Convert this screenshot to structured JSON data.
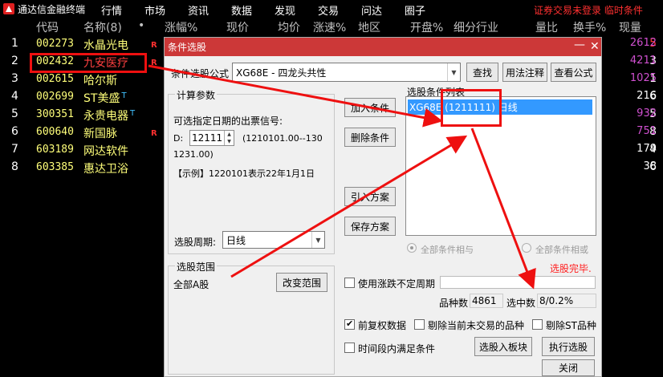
{
  "app": {
    "title": "通达信金融终端"
  },
  "menu": [
    "行情",
    "市场",
    "资讯",
    "数据",
    "发现",
    "交易",
    "问达",
    "圈子"
  ],
  "status_msg": "证券交易未登录 临时条件",
  "columns": [
    "代码",
    "名称(8)",
    "•",
    "涨幅%",
    "现价",
    "均价",
    "涨速%",
    "地区",
    "开盘%",
    "细分行业",
    "量比",
    "换手%",
    "现量"
  ],
  "rows": [
    {
      "idx": "1",
      "code": "002273",
      "name": "水晶光电",
      "flag": "R",
      "t": "",
      "tail": "5",
      "last": "2612"
    },
    {
      "idx": "2",
      "code": "002432",
      "name": "九安医疗",
      "flag": "R",
      "t": "",
      "tail": "3",
      "last": "4211"
    },
    {
      "idx": "3",
      "code": "002615",
      "name": "哈尔斯",
      "flag": "",
      "t": "",
      "tail": "1",
      "last": "1025"
    },
    {
      "idx": "4",
      "code": "002699",
      "name": "ST美盛",
      "flag": "",
      "t": "T",
      "tail": "6",
      "last": "216"
    },
    {
      "idx": "5",
      "code": "300351",
      "name": "永贵电器",
      "flag": "",
      "t": "T",
      "tail": "5",
      "last": "932"
    },
    {
      "idx": "6",
      "code": "600640",
      "name": "新国脉",
      "flag": "R",
      "t": "",
      "tail": "8",
      "last": "751"
    },
    {
      "idx": "7",
      "code": "603189",
      "name": "网达软件",
      "flag": "",
      "t": "",
      "tail": "4",
      "last": "179"
    },
    {
      "idx": "8",
      "code": "603385",
      "name": "惠达卫浴",
      "flag": "",
      "t": "",
      "tail": "6",
      "last": "38"
    }
  ],
  "colors": {
    "last_purple": "#d050d0",
    "last_white": "#ffffff",
    "tail_red": "#ff3030",
    "tail_white": "#ffffff"
  },
  "dialog": {
    "title": "条件选股",
    "formula_label": "条件选股公式",
    "formula_value": "XG68E         - 四龙头共性",
    "btn_find": "查找",
    "btn_usage": "用法注释",
    "btn_view": "查看公式",
    "params_caption": "计算参数",
    "params_hint": "可选指定日期的出票信号:",
    "d_label": "D:",
    "d_value": "12111",
    "d_range": "(1210101.00--130",
    "d_range2": "1231.00)",
    "example": "【示例】1220101表示22年1月1日",
    "btn_add": "加入条件",
    "btn_del": "删除条件",
    "btn_import": "引入方案",
    "btn_save": "保存方案",
    "list_caption": "选股条件列表",
    "list_item": "XG68E (1211111) 日线",
    "radio_and": "全部条件相与",
    "radio_or": "全部条件相或",
    "period_label": "选股周期:",
    "period_value": "日线",
    "status": "选股完毕.",
    "range_caption": "选股范围",
    "range_value": "全部A股",
    "btn_range": "改变范围",
    "use_uncertain": "使用涨跌不定周期",
    "count_label": "品种数",
    "count_value": "4861",
    "selected_label": "选中数",
    "selected_value": "8/0.2%",
    "adj_label": "前复权数据",
    "remove_untrade": "剔除当前未交易的品种",
    "remove_st": "剔除ST品种",
    "time_label": "时间段内满足条件",
    "btn_to_block": "选股入板块",
    "btn_exec": "执行选股",
    "btn_close": "关闭"
  }
}
